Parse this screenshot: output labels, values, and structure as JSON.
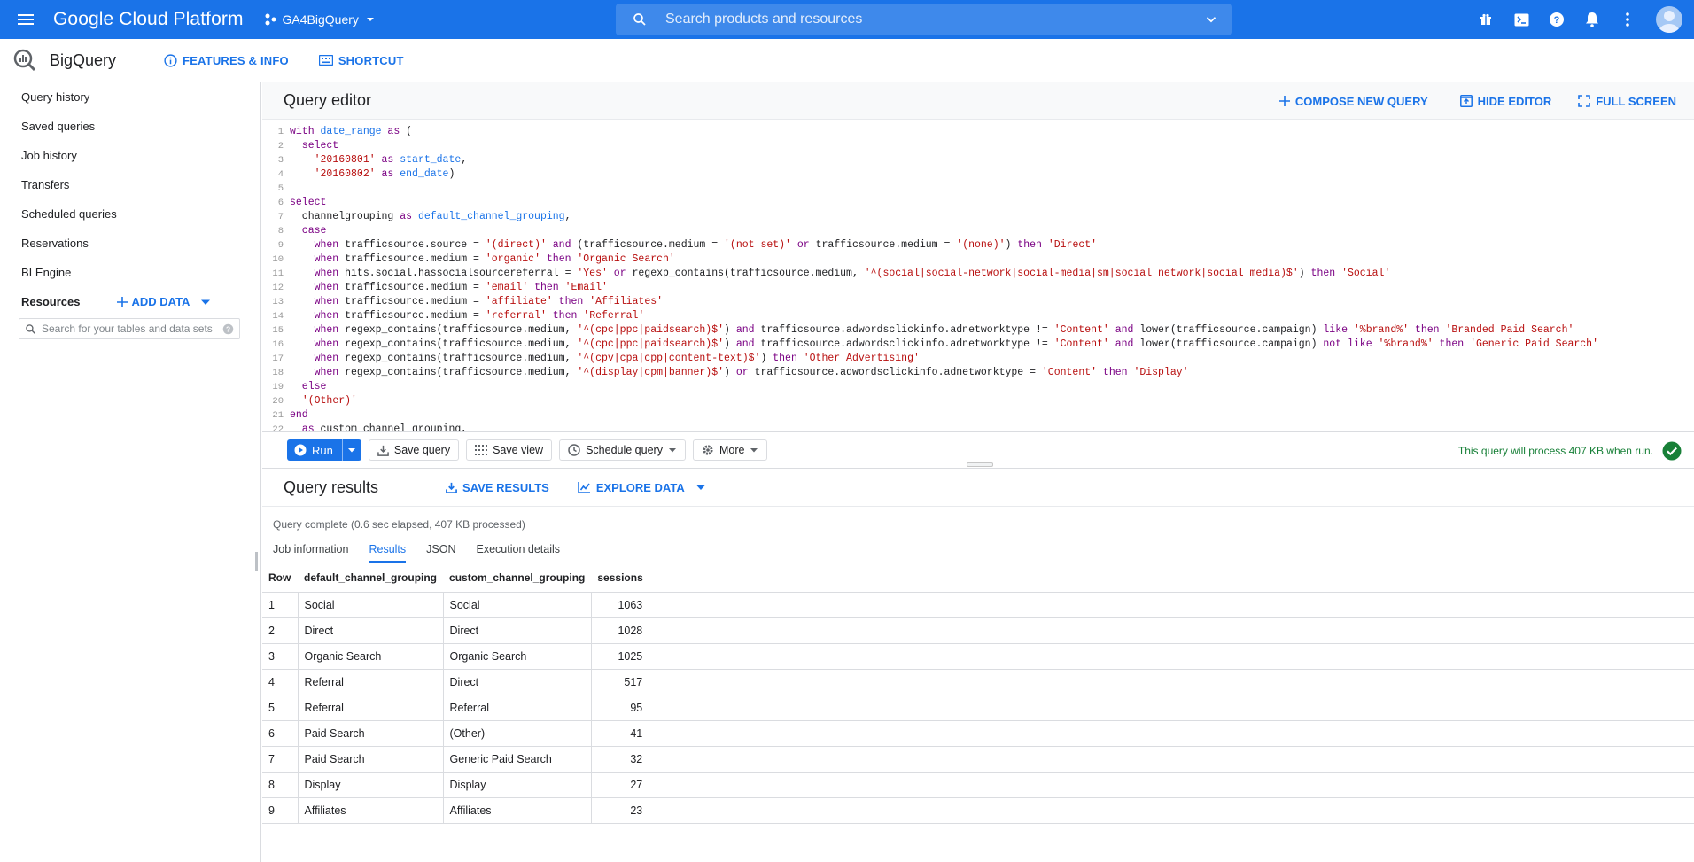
{
  "topbar": {
    "brand": "Google Cloud Platform",
    "project": "GA4BigQuery",
    "search_placeholder": "Search products and resources"
  },
  "appbar": {
    "product": "BigQuery",
    "features": "FEATURES & INFO",
    "shortcut": "SHORTCUT"
  },
  "sidebar": {
    "items": [
      "Query history",
      "Saved queries",
      "Job history",
      "Transfers",
      "Scheduled queries",
      "Reservations",
      "BI Engine"
    ],
    "resources_label": "Resources",
    "add_data": "ADD DATA",
    "search_placeholder": "Search for your tables and data sets"
  },
  "editor": {
    "title": "Query editor",
    "compose": "COMPOSE NEW QUERY",
    "hide": "HIDE EDITOR",
    "fullscreen": "FULL SCREEN",
    "lines": [
      [
        [
          "kw",
          "with "
        ],
        [
          "id",
          "date_range"
        ],
        [
          "kw",
          " as "
        ],
        [
          "p",
          "("
        ]
      ],
      [
        [
          "kw",
          "  select"
        ]
      ],
      [
        [
          "p",
          "    "
        ],
        [
          "str",
          "'20160801'"
        ],
        [
          "kw",
          " as "
        ],
        [
          "id",
          "start_date"
        ],
        [
          "p",
          ","
        ]
      ],
      [
        [
          "p",
          "    "
        ],
        [
          "str",
          "'20160802'"
        ],
        [
          "kw",
          " as "
        ],
        [
          "id",
          "end_date"
        ],
        [
          "p",
          ")"
        ]
      ],
      [],
      [
        [
          "kw",
          "select"
        ]
      ],
      [
        [
          "p",
          "  channelgrouping"
        ],
        [
          "kw",
          " as "
        ],
        [
          "id",
          "default_channel_grouping"
        ],
        [
          "p",
          ","
        ]
      ],
      [
        [
          "kw",
          "  case"
        ]
      ],
      [
        [
          "kw",
          "    when "
        ],
        [
          "p",
          "trafficsource.source = "
        ],
        [
          "str",
          "'(direct)'"
        ],
        [
          "kw",
          " and "
        ],
        [
          "p",
          "(trafficsource.medium = "
        ],
        [
          "str",
          "'(not set)'"
        ],
        [
          "kw",
          " or "
        ],
        [
          "p",
          "trafficsource.medium = "
        ],
        [
          "str",
          "'(none)'"
        ],
        [
          "p",
          ") "
        ],
        [
          "kw",
          "then "
        ],
        [
          "str",
          "'Direct'"
        ]
      ],
      [
        [
          "kw",
          "    when "
        ],
        [
          "p",
          "trafficsource.medium = "
        ],
        [
          "str",
          "'organic'"
        ],
        [
          "kw",
          " then "
        ],
        [
          "str",
          "'Organic Search'"
        ]
      ],
      [
        [
          "kw",
          "    when "
        ],
        [
          "p",
          "hits.social.hassocialsourcereferral = "
        ],
        [
          "str",
          "'Yes'"
        ],
        [
          "kw",
          " or "
        ],
        [
          "p",
          "regexp_contains(trafficsource.medium, "
        ],
        [
          "str",
          "'^(social|social-network|social-media|sm|social network|social media)$'"
        ],
        [
          "p",
          ") "
        ],
        [
          "kw",
          "then "
        ],
        [
          "str",
          "'Social'"
        ]
      ],
      [
        [
          "kw",
          "    when "
        ],
        [
          "p",
          "trafficsource.medium = "
        ],
        [
          "str",
          "'email'"
        ],
        [
          "kw",
          " then "
        ],
        [
          "str",
          "'Email'"
        ]
      ],
      [
        [
          "kw",
          "    when "
        ],
        [
          "p",
          "trafficsource.medium = "
        ],
        [
          "str",
          "'affiliate'"
        ],
        [
          "kw",
          " then "
        ],
        [
          "str",
          "'Affiliates'"
        ]
      ],
      [
        [
          "kw",
          "    when "
        ],
        [
          "p",
          "trafficsource.medium = "
        ],
        [
          "str",
          "'referral'"
        ],
        [
          "kw",
          " then "
        ],
        [
          "str",
          "'Referral'"
        ]
      ],
      [
        [
          "kw",
          "    when "
        ],
        [
          "p",
          "regexp_contains(trafficsource.medium, "
        ],
        [
          "str",
          "'^(cpc|ppc|paidsearch)$'"
        ],
        [
          "p",
          ") "
        ],
        [
          "kw",
          "and "
        ],
        [
          "p",
          "trafficsource.adwordsclickinfo.adnetworktype != "
        ],
        [
          "str",
          "'Content'"
        ],
        [
          "kw",
          " and "
        ],
        [
          "p",
          "lower(trafficsource.campaign) "
        ],
        [
          "kw",
          "like "
        ],
        [
          "str",
          "'%brand%'"
        ],
        [
          "kw",
          " then "
        ],
        [
          "str",
          "'Branded Paid Search'"
        ]
      ],
      [
        [
          "kw",
          "    when "
        ],
        [
          "p",
          "regexp_contains(trafficsource.medium, "
        ],
        [
          "str",
          "'^(cpc|ppc|paidsearch)$'"
        ],
        [
          "p",
          ") "
        ],
        [
          "kw",
          "and "
        ],
        [
          "p",
          "trafficsource.adwordsclickinfo.adnetworktype != "
        ],
        [
          "str",
          "'Content'"
        ],
        [
          "kw",
          " and "
        ],
        [
          "p",
          "lower(trafficsource.campaign) "
        ],
        [
          "kw",
          "not like "
        ],
        [
          "str",
          "'%brand%'"
        ],
        [
          "kw",
          " then "
        ],
        [
          "str",
          "'Generic Paid Search'"
        ]
      ],
      [
        [
          "kw",
          "    when "
        ],
        [
          "p",
          "regexp_contains(trafficsource.medium, "
        ],
        [
          "str",
          "'^(cpv|cpa|cpp|content-text)$'"
        ],
        [
          "p",
          ") "
        ],
        [
          "kw",
          "then "
        ],
        [
          "str",
          "'Other Advertising'"
        ]
      ],
      [
        [
          "kw",
          "    when "
        ],
        [
          "p",
          "regexp_contains(trafficsource.medium, "
        ],
        [
          "str",
          "'^(display|cpm|banner)$'"
        ],
        [
          "p",
          ") "
        ],
        [
          "kw",
          "or "
        ],
        [
          "p",
          "trafficsource.adwordsclickinfo.adnetworktype = "
        ],
        [
          "str",
          "'Content'"
        ],
        [
          "kw",
          " then "
        ],
        [
          "str",
          "'Display'"
        ]
      ],
      [
        [
          "kw",
          "  else"
        ]
      ],
      [
        [
          "p",
          "  "
        ],
        [
          "str",
          "'(Other)'"
        ]
      ],
      [
        [
          "kw",
          "end"
        ]
      ],
      [
        [
          "kw",
          "  as "
        ],
        [
          "p",
          "custom_channel_grouping,"
        ]
      ]
    ]
  },
  "toolbar": {
    "run": "Run",
    "save_query": "Save query",
    "save_view": "Save view",
    "schedule": "Schedule query",
    "more": "More",
    "validator": "This query will process 407 KB when run."
  },
  "results": {
    "title": "Query results",
    "save": "SAVE RESULTS",
    "explore": "EXPLORE DATA",
    "status": "Query complete (0.6 sec elapsed, 407 KB processed)",
    "tabs": [
      "Job information",
      "Results",
      "JSON",
      "Execution details"
    ],
    "active_tab": 1,
    "columns": [
      "Row",
      "default_channel_grouping",
      "custom_channel_grouping",
      "sessions"
    ],
    "rows": [
      [
        "1",
        "Social",
        "Social",
        "1063"
      ],
      [
        "2",
        "Direct",
        "Direct",
        "1028"
      ],
      [
        "3",
        "Organic Search",
        "Organic Search",
        "1025"
      ],
      [
        "4",
        "Referral",
        "Direct",
        "517"
      ],
      [
        "5",
        "Referral",
        "Referral",
        "95"
      ],
      [
        "6",
        "Paid Search",
        "(Other)",
        "41"
      ],
      [
        "7",
        "Paid Search",
        "Generic Paid Search",
        "32"
      ],
      [
        "8",
        "Display",
        "Display",
        "27"
      ],
      [
        "9",
        "Affiliates",
        "Affiliates",
        "23"
      ]
    ]
  },
  "colors": {
    "primary": "#1a73e8",
    "success": "#188038",
    "keyword": "#7a0083",
    "string": "#b80f0f"
  }
}
